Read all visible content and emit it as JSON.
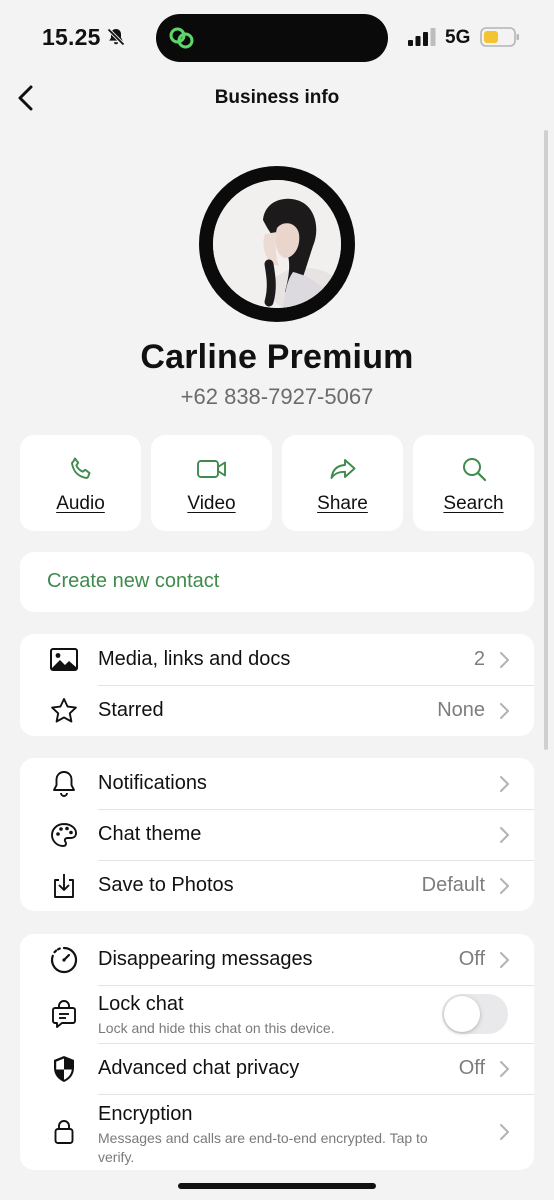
{
  "status_bar": {
    "time": "15.25",
    "network": "5G",
    "battery_color": "#f4c430",
    "bell_muted": true
  },
  "nav": {
    "title": "Business info",
    "back_icon": "chevron-left-icon"
  },
  "profile": {
    "name": "Carline Premium",
    "phone": "+62 838-7927-5067"
  },
  "actions": [
    {
      "label": "Audio",
      "icon": "phone-icon"
    },
    {
      "label": "Video",
      "icon": "video-icon"
    },
    {
      "label": "Share",
      "icon": "share-icon"
    },
    {
      "label": "Search",
      "icon": "search-icon"
    }
  ],
  "accent_color": "#3f8a4d",
  "create_contact": {
    "label": "Create new contact"
  },
  "group1": [
    {
      "label": "Media, links and docs",
      "value": "2",
      "icon": "image-icon"
    },
    {
      "label": "Starred",
      "value": "None",
      "icon": "star-icon"
    }
  ],
  "group2": [
    {
      "label": "Notifications",
      "value": "",
      "icon": "bell-icon"
    },
    {
      "label": "Chat theme",
      "value": "",
      "icon": "palette-icon"
    },
    {
      "label": "Save to Photos",
      "value": "Default",
      "icon": "download-icon"
    }
  ],
  "group3": [
    {
      "label": "Disappearing messages",
      "value": "Off",
      "icon": "timer-icon"
    },
    {
      "label": "Lock chat",
      "subtitle": "Lock and hide this chat on this device.",
      "toggle": false,
      "icon": "lock-chat-icon"
    },
    {
      "label": "Advanced chat privacy",
      "value": "Off",
      "icon": "shield-icon"
    },
    {
      "label": "Encryption",
      "subtitle": "Messages and calls are end-to-end encrypted. Tap to verify.",
      "icon": "lock-icon"
    }
  ]
}
